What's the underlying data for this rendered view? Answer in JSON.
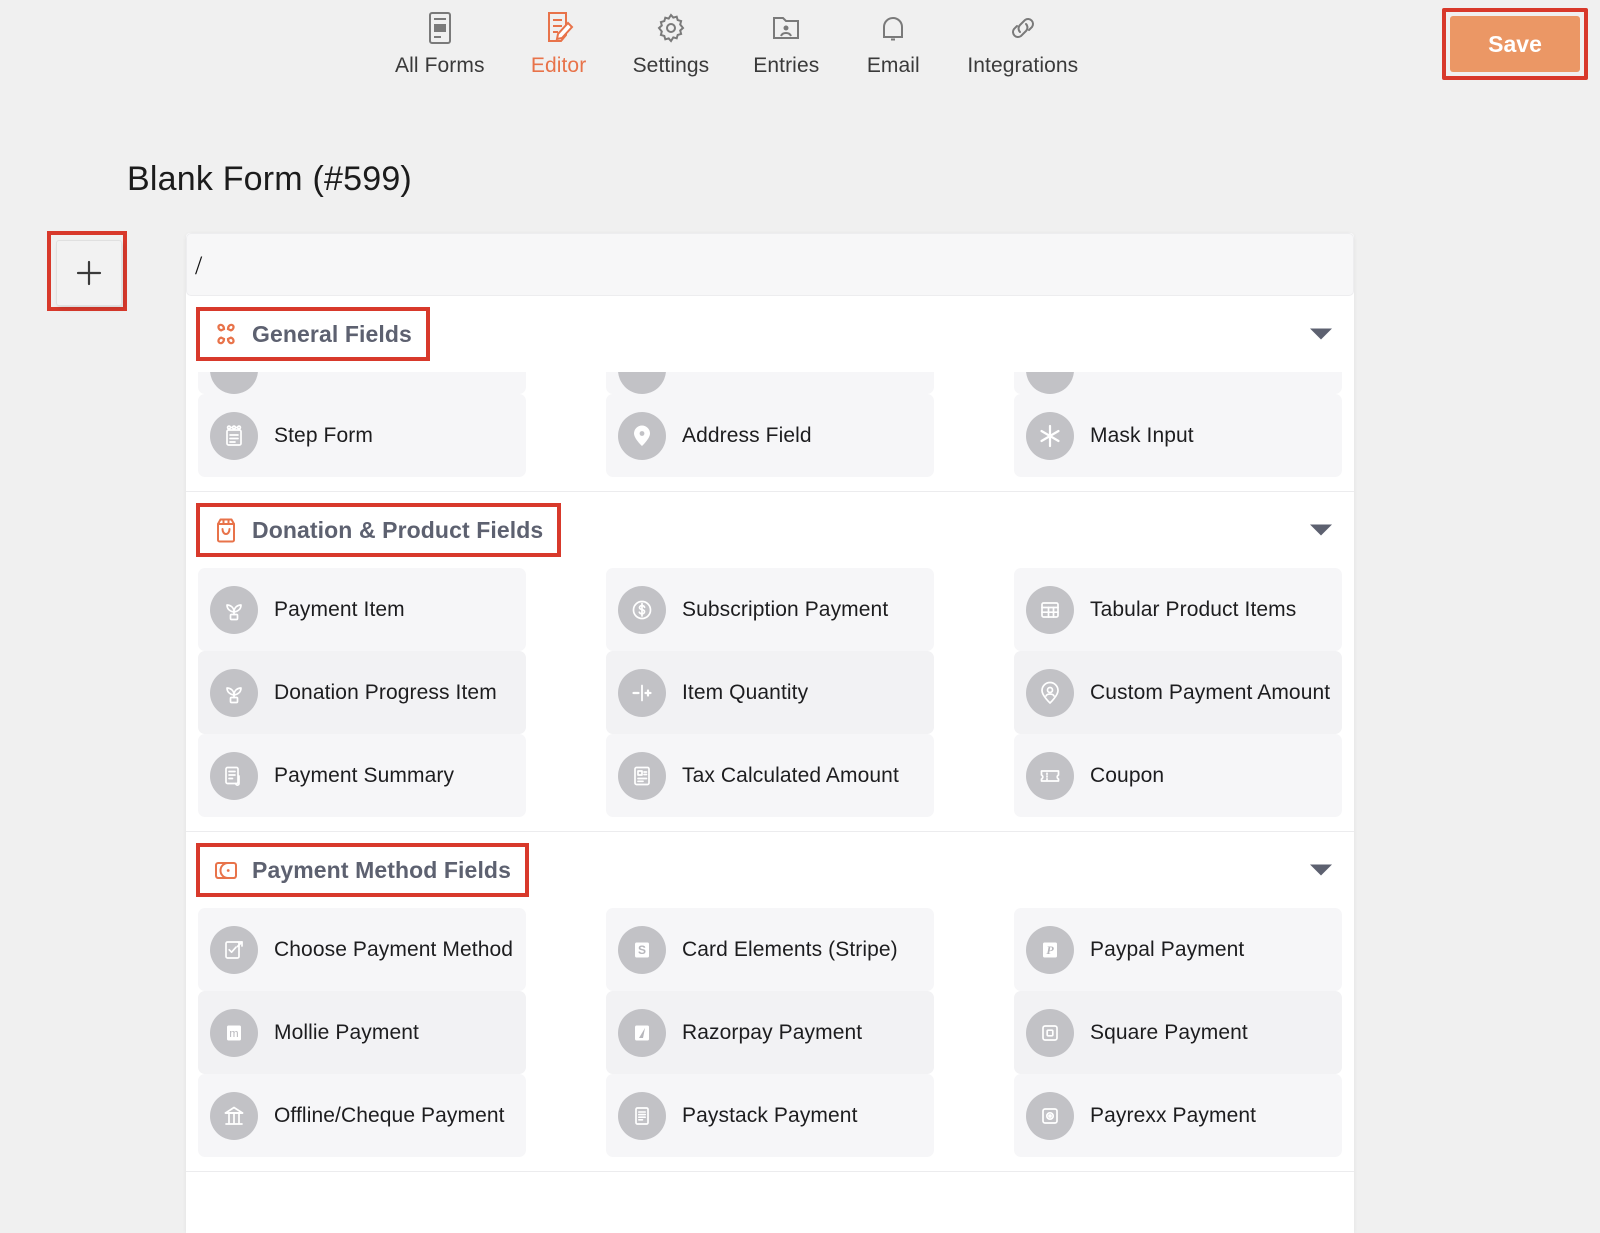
{
  "nav": {
    "items": [
      {
        "label": "All Forms",
        "icon": "forms-icon",
        "active": false
      },
      {
        "label": "Editor",
        "icon": "editor-pencil-icon",
        "active": true
      },
      {
        "label": "Settings",
        "icon": "gear-icon",
        "active": false
      },
      {
        "label": "Entries",
        "icon": "entries-folder-icon",
        "active": false
      },
      {
        "label": "Email",
        "icon": "bell-icon",
        "active": false
      },
      {
        "label": "Integrations",
        "icon": "link-icon",
        "active": false
      }
    ]
  },
  "toolbar": {
    "save_label": "Save"
  },
  "page": {
    "title": "Blank Form (#599)"
  },
  "add_button": {
    "icon": "plus-icon",
    "label": ""
  },
  "search": {
    "value": "/",
    "placeholder": ""
  },
  "colors": {
    "accent": "#e8734a",
    "save_bg": "#eb9765",
    "annotation": "#d8392b",
    "section_title": "#5d6170",
    "tile_bg": "#f6f6f8",
    "icon_circle": "#c2c2c6",
    "page_bg": "#f0f0f0"
  },
  "sections": [
    {
      "title": "General Fields",
      "icon": "general-fields-icon",
      "chevron": "chevron-down-icon",
      "clipped_row": true,
      "rows": [
        [
          {
            "label": "Step Form",
            "icon": "step-form-icon"
          },
          {
            "label": "Address Field",
            "icon": "location-pin-icon"
          },
          {
            "label": "Mask Input",
            "icon": "asterisk-icon"
          }
        ]
      ]
    },
    {
      "title": "Donation & Product Fields",
      "icon": "donation-bag-icon",
      "chevron": "chevron-down-icon",
      "clipped_row": false,
      "rows": [
        [
          {
            "label": "Payment Item",
            "icon": "plant-icon"
          },
          {
            "label": "Subscription Payment",
            "icon": "dollar-circle-icon"
          },
          {
            "label": "Tabular Product Items",
            "icon": "table-icon"
          }
        ],
        [
          {
            "label": "Donation Progress Item",
            "icon": "plant-icon"
          },
          {
            "label": "Item Quantity",
            "icon": "minus-plus-icon"
          },
          {
            "label": "Custom Payment Amount",
            "icon": "user-pin-icon"
          }
        ],
        [
          {
            "label": "Payment Summary",
            "icon": "summary-doc-icon"
          },
          {
            "label": "Tax Calculated Amount",
            "icon": "tax-doc-icon"
          },
          {
            "label": "Coupon",
            "icon": "coupon-ticket-icon"
          }
        ]
      ]
    },
    {
      "title": "Payment Method Fields",
      "icon": "wallet-icon",
      "chevron": "chevron-down-icon",
      "clipped_row": false,
      "rows": [
        [
          {
            "label": "Choose Payment Method",
            "icon": "choose-method-icon"
          },
          {
            "label": "Card Elements (Stripe)",
            "icon": "stripe-s-icon"
          },
          {
            "label": "Paypal Payment",
            "icon": "paypal-p-icon"
          }
        ],
        [
          {
            "label": "Mollie Payment",
            "icon": "mollie-m-icon"
          },
          {
            "label": "Razorpay Payment",
            "icon": "razorpay-icon"
          },
          {
            "label": "Square Payment",
            "icon": "square-icon"
          }
        ],
        [
          {
            "label": "Offline/Cheque Payment",
            "icon": "bank-icon"
          },
          {
            "label": "Paystack Payment",
            "icon": "paystack-lines-icon"
          },
          {
            "label": "Payrexx Payment",
            "icon": "payrexx-icon"
          }
        ]
      ]
    }
  ]
}
